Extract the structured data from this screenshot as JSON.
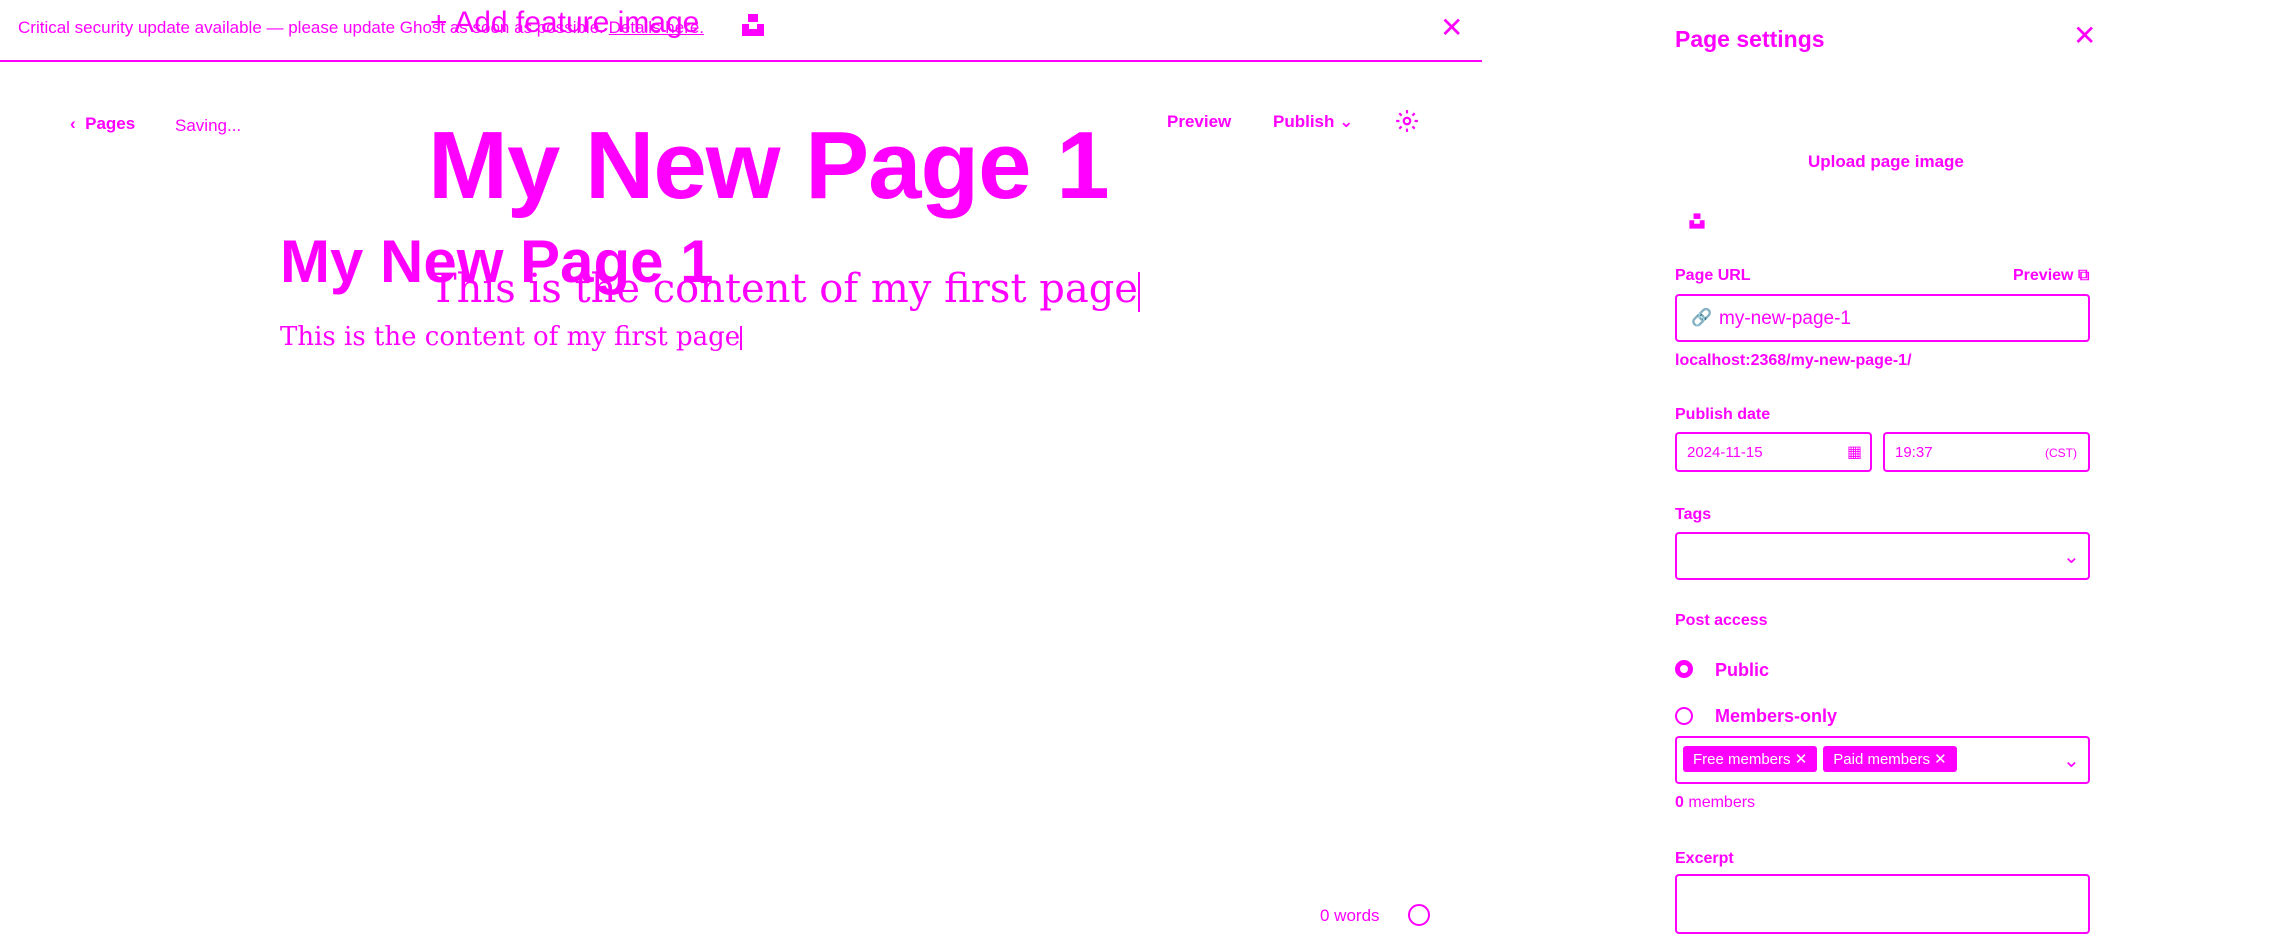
{
  "banner": {
    "text": "Critical security update available — please update Ghost as soon as possible.",
    "link": "Details here."
  },
  "topbar": {
    "back": "Pages",
    "status": "Saving...",
    "preview": "Preview",
    "publish": "Publish"
  },
  "editor": {
    "feature_image": "+ Add feature image",
    "title_big": "My New Page 1",
    "title_mid": "My New Page 1",
    "content_big": "This is the content of my first page",
    "content_small": "This is the content of my first page",
    "word_count": "0 words"
  },
  "settings": {
    "title": "Page settings",
    "upload": "Upload page image",
    "url_label": "Page URL",
    "url_preview": "Preview",
    "url_value": "my-new-page-1",
    "url_full": "localhost:2368/my-new-page-1/",
    "publish_date_label": "Publish date",
    "date": "2024-11-15",
    "time": "19:37",
    "timezone": "(CST)",
    "tags_label": "Tags",
    "access_label": "Post access",
    "access_public": "Public",
    "access_members": "Members-only",
    "segments": [
      "Free members",
      "Paid members"
    ],
    "members_count": "0",
    "members_text": "members",
    "excerpt_label": "Excerpt"
  },
  "colors": {
    "accent": "#ff00ff",
    "background": "#ffffff"
  }
}
